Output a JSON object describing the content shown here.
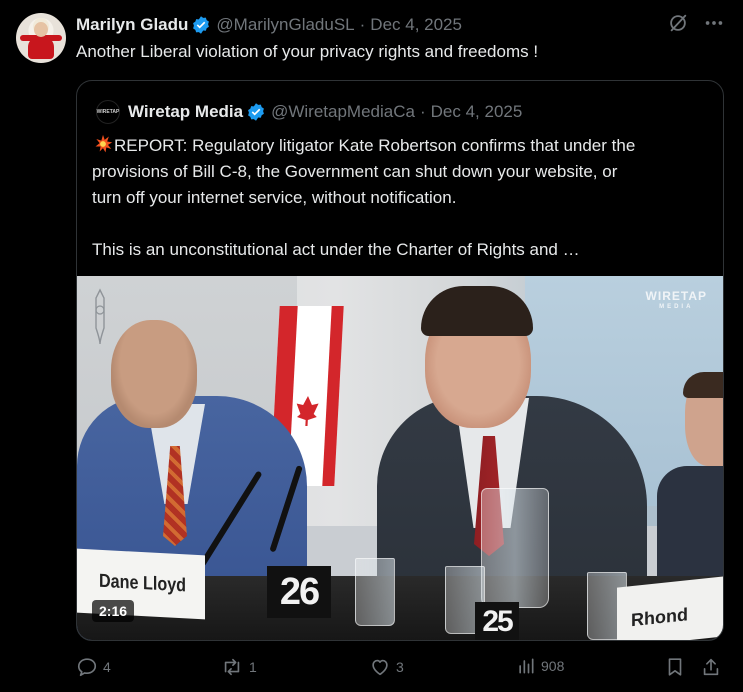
{
  "post": {
    "author_name": "Marilyn Gladu",
    "author_handle": "@MarilynGladuSL",
    "date": "Dec 4, 2025",
    "text": "Another Liberal violation of your privacy rights and freedoms !"
  },
  "quote": {
    "author_name": "Wiretap Media",
    "author_handle": "@WiretapMediaCa",
    "date": "Dec 4, 2025",
    "avatar_text": "WIRETAP",
    "line1": "REPORT: Regulatory litigator Kate Robertson confirms that under the",
    "line2": "provisions of Bill C-8, the Government can shut down your website, or",
    "line3": "turn off your internet service, without notification.",
    "line4": "This is an unconstitutional act under the Charter of Rights and …",
    "video": {
      "duration": "2:16",
      "watermark_line1": "WIRETAP",
      "watermark_line2": "MEDIA",
      "nameplate1": "Dane Lloyd",
      "nameplate2": "Rhond",
      "card1": "26",
      "card2": "25"
    }
  },
  "actions": {
    "replies": "4",
    "reposts": "1",
    "likes": "3",
    "views": "908"
  },
  "colors": {
    "background": "#000000",
    "text": "#e7e9ea",
    "muted": "#71767b",
    "border": "#2f3336",
    "verified": "#1d9bf0"
  }
}
